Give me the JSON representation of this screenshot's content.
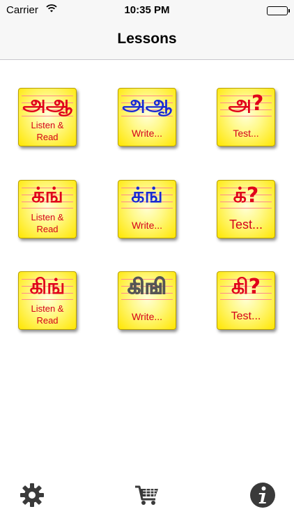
{
  "status_bar": {
    "carrier": "Carrier",
    "time": "10:35 PM"
  },
  "nav": {
    "title": "Lessons"
  },
  "lessons": [
    {
      "glyph": "அஆ",
      "caption": "Listen &\nRead",
      "style": "red"
    },
    {
      "glyph": "அஆ",
      "caption": "Write...",
      "style": "blue"
    },
    {
      "glyph": "அ?",
      "caption": "Test...",
      "style": "red"
    },
    {
      "glyph": "க்ங்",
      "caption": "Listen &\nRead",
      "style": "red"
    },
    {
      "glyph": "க்ங்",
      "caption": "Write...",
      "style": "blue"
    },
    {
      "glyph": "க்?",
      "caption": "Test...",
      "style": "red"
    },
    {
      "glyph": "கிங்",
      "caption": "Listen &\nRead",
      "style": "red"
    },
    {
      "glyph": "கிஙி",
      "caption": "Write...",
      "style": "dotted"
    },
    {
      "glyph": "கி?",
      "caption": "Test...",
      "style": "red"
    }
  ],
  "tab_bar": {
    "icons": [
      "gear-icon",
      "cart-icon",
      "info-icon"
    ]
  },
  "colors": {
    "tile_yellow": "#ffe600",
    "text_red": "#d4001a",
    "write_blue": "#1a2bd0",
    "icon_dark": "#3a3a3a"
  }
}
